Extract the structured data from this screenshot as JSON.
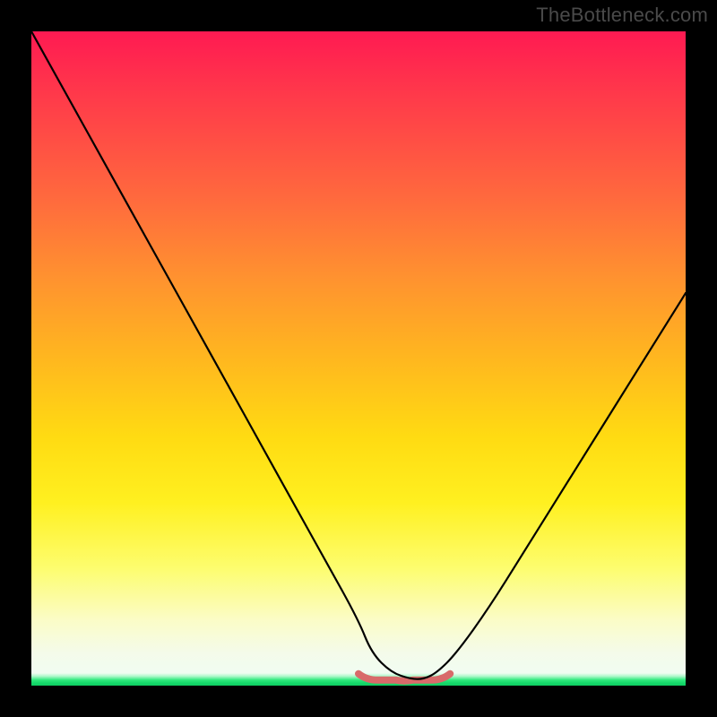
{
  "watermark": "TheBottleneck.com",
  "chart_data": {
    "type": "line",
    "title": "",
    "xlabel": "",
    "ylabel": "",
    "xlim": [
      0,
      100
    ],
    "ylim": [
      0,
      100
    ],
    "grid": false,
    "legend": false,
    "series": [
      {
        "name": "bottleneck-curve",
        "x": [
          0,
          5,
          10,
          15,
          20,
          25,
          30,
          35,
          40,
          45,
          50,
          52,
          55,
          58,
          60,
          62,
          65,
          70,
          75,
          80,
          85,
          90,
          95,
          100
        ],
        "y": [
          100,
          91,
          82,
          73,
          64,
          55,
          46,
          37,
          28,
          19,
          10,
          5,
          2,
          1,
          1,
          2,
          5,
          12,
          20,
          28,
          36,
          44,
          52,
          60
        ]
      }
    ],
    "highlight_range": {
      "name": "optimal-zone",
      "x": [
        50,
        64
      ],
      "y_approx": 1,
      "color": "#d86a6a"
    },
    "background_gradient": {
      "stops": [
        {
          "pos": 0.0,
          "color": "#ff1a52"
        },
        {
          "pos": 0.1,
          "color": "#ff3a4a"
        },
        {
          "pos": 0.26,
          "color": "#ff6b3d"
        },
        {
          "pos": 0.38,
          "color": "#ff932f"
        },
        {
          "pos": 0.5,
          "color": "#ffb71f"
        },
        {
          "pos": 0.62,
          "color": "#ffdb12"
        },
        {
          "pos": 0.72,
          "color": "#fff020"
        },
        {
          "pos": 0.82,
          "color": "#fdfd6e"
        },
        {
          "pos": 0.9,
          "color": "#fbfcc7"
        },
        {
          "pos": 0.95,
          "color": "#f4fbea"
        },
        {
          "pos": 1.0,
          "color": "#effdf6"
        }
      ],
      "baseline_band_color": "#14d86a"
    }
  }
}
